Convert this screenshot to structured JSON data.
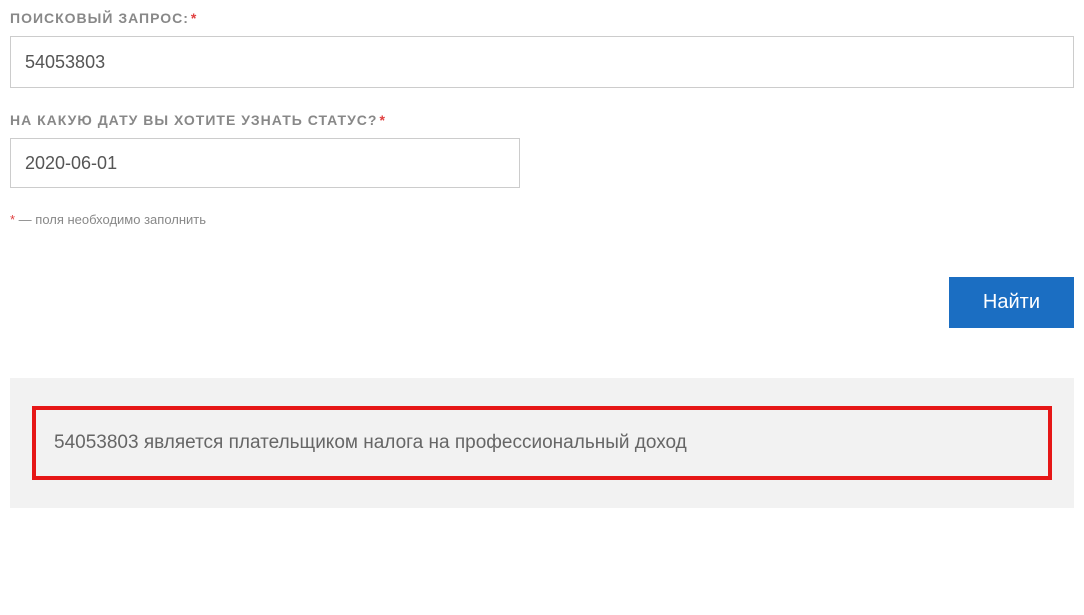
{
  "search": {
    "label": "ПОИСКОВЫЙ ЗАПРОС:",
    "value": "54053803"
  },
  "date": {
    "label": "НА КАКУЮ ДАТУ ВЫ ХОТИТЕ УЗНАТЬ СТАТУС?",
    "value": "2020-06-01"
  },
  "required_mark": "*",
  "note": {
    "prefix": "*",
    "text": " — поля необходимо заполнить"
  },
  "button": {
    "submit": "Найти"
  },
  "result": {
    "text": "54053803      является плательщиком налога на профессиональный доход"
  }
}
